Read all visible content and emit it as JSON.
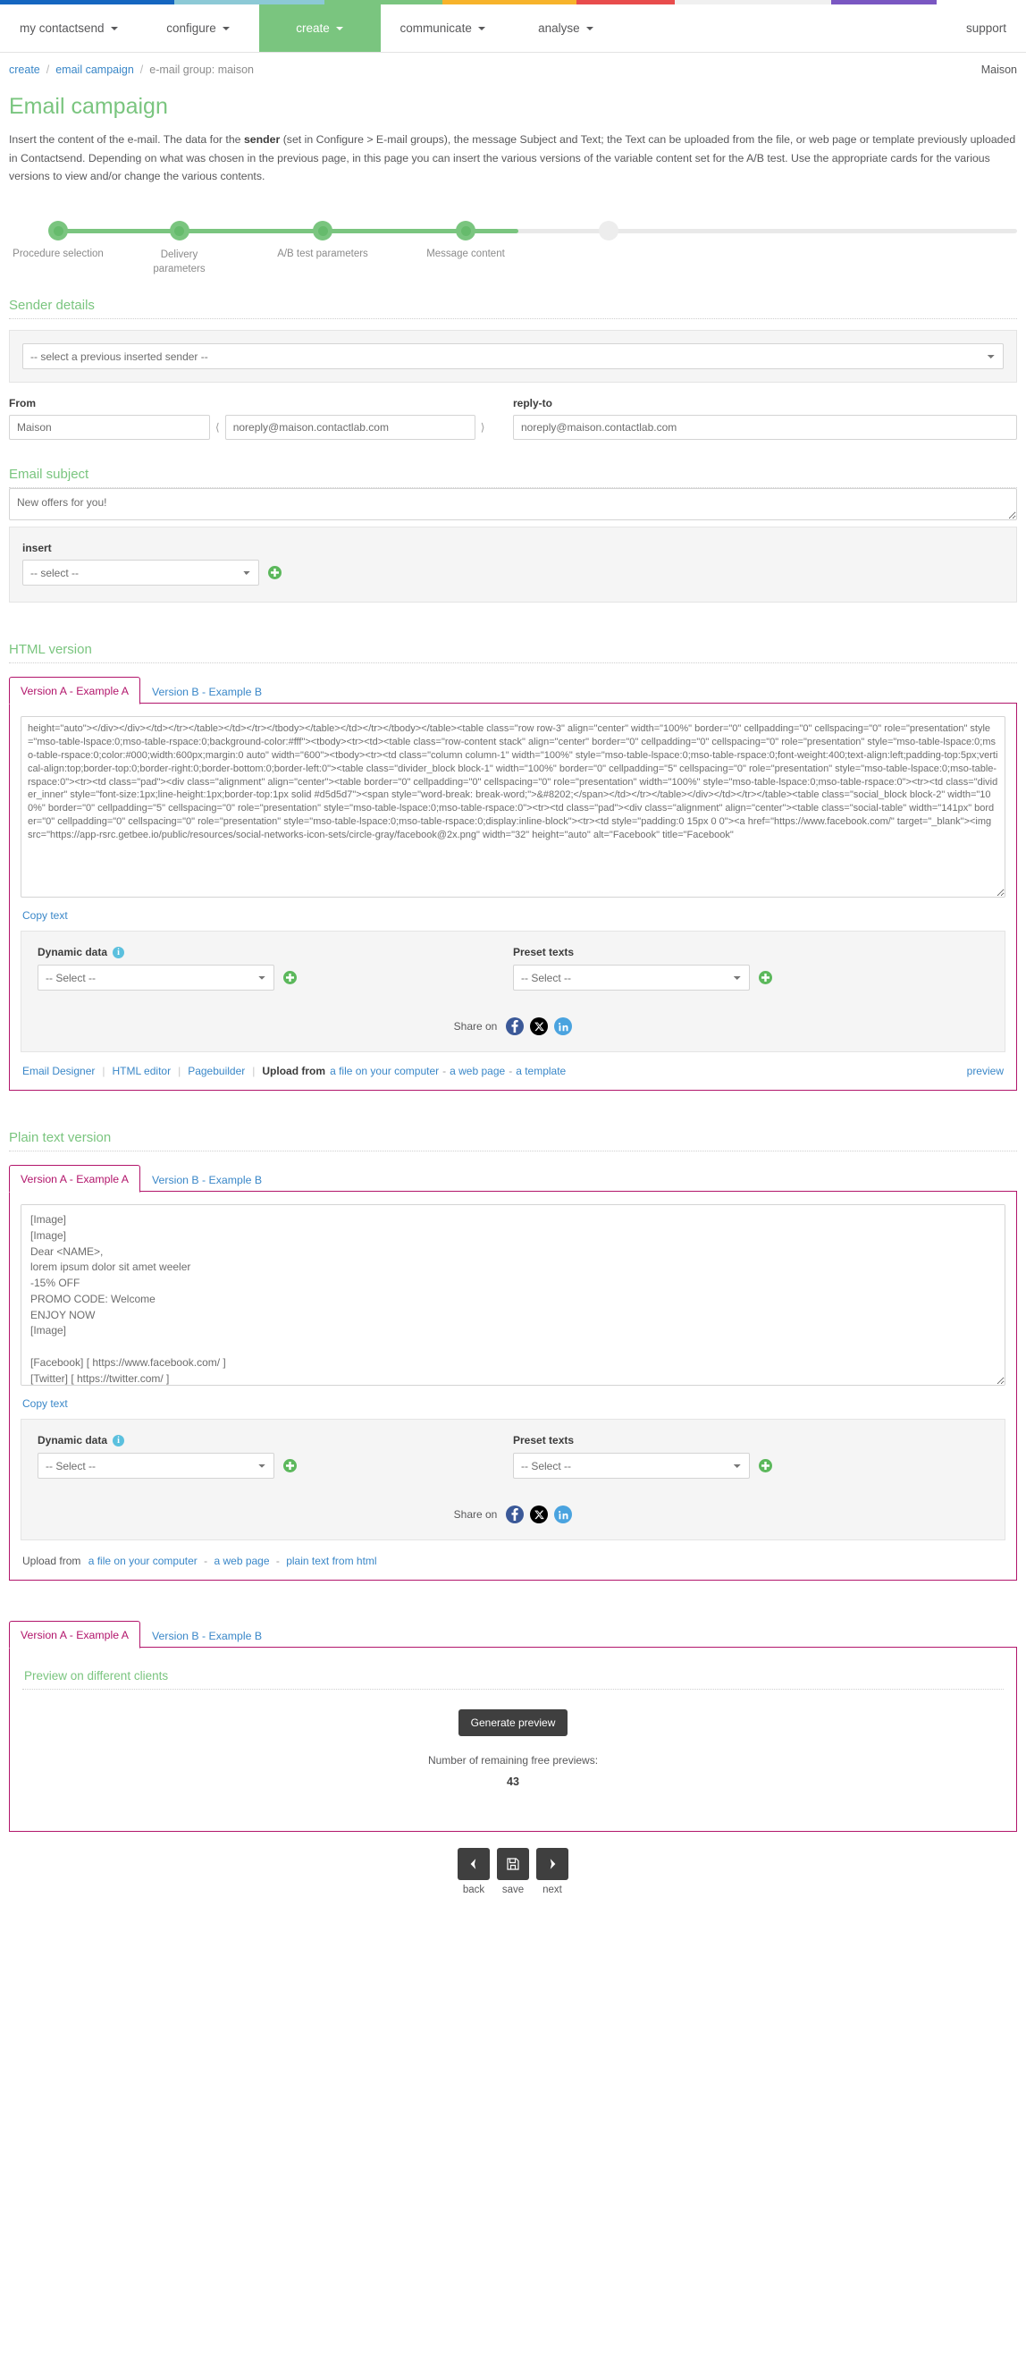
{
  "topstrip": {
    "segments": [
      {
        "color": "#1566c0",
        "width": 195
      },
      {
        "color": "#8cc9d6",
        "width": 168
      },
      {
        "color": "#7ac57f",
        "width": 132
      },
      {
        "color": "#f7b32b",
        "width": 150
      },
      {
        "color": "#e84c4c",
        "width": 110
      },
      {
        "color": "#f0f0f0",
        "width": 175
      },
      {
        "color": "#7a57c2",
        "width": 118
      }
    ]
  },
  "nav": {
    "items": [
      {
        "label": "my contactsend",
        "caret": true,
        "active": false
      },
      {
        "label": "configure",
        "caret": true,
        "active": false
      },
      {
        "label": "create",
        "caret": true,
        "active": true
      },
      {
        "label": "communicate",
        "caret": true,
        "active": false
      },
      {
        "label": "analyse",
        "caret": true,
        "active": false
      }
    ],
    "support_label": "support"
  },
  "breadcrumb": {
    "items": [
      "create",
      "email campaign",
      "e-mail group: maison"
    ],
    "account": "Maison"
  },
  "header": {
    "title": "Email campaign",
    "intro_part1": "Insert the content of the e-mail. The data for the ",
    "intro_bold": "sender",
    "intro_part2": " (set in Configure > E-mail groups), the message Subject and Text; the Text can be uploaded from the file, or web page or template previously uploaded in Contactsend. Depending on what was chosen in the previous page, in this page you can insert the various versions of the variable content set for the A/B test. Use the appropriate cards for the various versions to view and/or change the various contents."
  },
  "stepper": {
    "steps": [
      {
        "label": "Procedure selection",
        "done": true
      },
      {
        "label": "Delivery parameters",
        "done": true
      },
      {
        "label": "A/B test parameters",
        "done": true
      },
      {
        "label": "Message content",
        "done": true
      },
      {
        "label": "",
        "done": false
      }
    ]
  },
  "sender": {
    "heading": "Sender details",
    "previous_sender_select": "-- select a previous inserted sender --",
    "from_label": "From",
    "from_name": "Maison",
    "from_email": "noreply@maison.contactlab.com",
    "replyto_label": "reply-to",
    "replyto_value": "noreply@maison.contactlab.com"
  },
  "subject": {
    "heading": "Email subject",
    "value": "New offers for you!",
    "insert_label": "insert",
    "insert_select": "-- select --"
  },
  "html_version": {
    "heading": "HTML version",
    "tabs": [
      {
        "label": "Version A - Example A",
        "active": true
      },
      {
        "label": "Version B - Example B",
        "active": false
      }
    ],
    "content": "height=\"auto\"></div></div></td></tr></table></td></tr></tbody></table></td></tr></tbody></table><table class=\"row row-3\" align=\"center\" width=\"100%\" border=\"0\" cellpadding=\"0\" cellspacing=\"0\" role=\"presentation\" style=\"mso-table-lspace:0;mso-table-rspace:0;background-color:#fff\"><tbody><tr><td><table class=\"row-content stack\" align=\"center\" border=\"0\" cellpadding=\"0\" cellspacing=\"0\" role=\"presentation\" style=\"mso-table-lspace:0;mso-table-rspace:0;color:#000;width:600px;margin:0 auto\" width=\"600\"><tbody><tr><td class=\"column column-1\" width=\"100%\" style=\"mso-table-lspace:0;mso-table-rspace:0;font-weight:400;text-align:left;padding-top:5px;vertical-align:top;border-top:0;border-right:0;border-bottom:0;border-left:0\"><table class=\"divider_block block-1\" width=\"100%\" border=\"0\" cellpadding=\"5\" cellspacing=\"0\" role=\"presentation\" style=\"mso-table-lspace:0;mso-table-rspace:0\"><tr><td class=\"pad\"><div class=\"alignment\" align=\"center\"><table border=\"0\" cellpadding=\"0\" cellspacing=\"0\" role=\"presentation\" width=\"100%\" style=\"mso-table-lspace:0;mso-table-rspace:0\"><tr><td class=\"divider_inner\" style=\"font-size:1px;line-height:1px;border-top:1px solid #d5d5d7\"><span style=\"word-break: break-word;\">&#8202;</span></td></tr></table></div></td></tr></table><table class=\"social_block block-2\" width=\"100%\" border=\"0\" cellpadding=\"5\" cellspacing=\"0\" role=\"presentation\" style=\"mso-table-lspace:0;mso-table-rspace:0\"><tr><td class=\"pad\"><div class=\"alignment\" align=\"center\"><table class=\"social-table\" width=\"141px\" border=\"0\" cellpadding=\"0\" cellspacing=\"0\" role=\"presentation\" style=\"mso-table-lspace:0;mso-table-rspace:0;display:inline-block\"><tr><td style=\"padding:0 15px 0 0\"><a href=\"https://www.facebook.com/\" target=\"_blank\"><img src=\"https://app-rsrc.getbee.io/public/resources/social-networks-icon-sets/circle-gray/facebook@2x.png\" width=\"32\" height=\"auto\" alt=\"Facebook\" title=\"Facebook\"",
    "copy_text": "Copy text",
    "dynamic_data_label": "Dynamic data",
    "dynamic_data_select": "-- Select --",
    "preset_texts_label": "Preset texts",
    "preset_texts_select": "-- Select --",
    "share_label": "Share on",
    "share_icons": [
      "facebook-icon",
      "x-twitter-icon",
      "linkedin-icon"
    ],
    "footer": {
      "email_designer": "Email Designer",
      "html_editor": "HTML editor",
      "pagebuilder": "Pagebuilder",
      "upload_from": "Upload from",
      "upload_file": "a file on your computer",
      "upload_webpage": "a web page",
      "upload_template": "a template",
      "preview": "preview"
    }
  },
  "plain_version": {
    "heading": "Plain text version",
    "tabs": [
      {
        "label": "Version A - Example A",
        "active": true
      },
      {
        "label": "Version B - Example B",
        "active": false
      }
    ],
    "content": "[Image]\n[Image]\nDear <NAME>,\nlorem ipsum dolor sit amet weeler\n-15% OFF\nPROMO CODE: Welcome\nENJOY NOW\n[Image]\n\n[Facebook] [ https://www.facebook.com/ ]\n[Twitter] [ https://twitter.com/ ]\n[Google+] [ https://plus.google.com/ ]",
    "copy_text": "Copy text",
    "dynamic_data_label": "Dynamic data",
    "dynamic_data_select": "-- Select --",
    "preset_texts_label": "Preset texts",
    "preset_texts_select": "-- Select --",
    "share_label": "Share on",
    "footer": {
      "upload_from": "Upload from",
      "upload_file": "a file on your computer",
      "upload_webpage": "a web page",
      "upload_plaintext": "plain text from html"
    }
  },
  "preview_card": {
    "tabs": [
      {
        "label": "Version A - Example A",
        "active": true
      },
      {
        "label": "Version B - Example B",
        "active": false
      }
    ],
    "heading": "Preview on different clients",
    "generate_button": "Generate preview",
    "remaining_label": "Number of remaining free previews:",
    "remaining_count": "43"
  },
  "bottom_nav": [
    {
      "label": "back",
      "icon": "chevron-left-icon"
    },
    {
      "label": "save",
      "icon": "floppy-disk-icon"
    },
    {
      "label": "next",
      "icon": "chevron-right-icon"
    }
  ],
  "colors": {
    "brand_green": "#7ac57f",
    "card_pink": "#b2156b",
    "link_blue": "#3a87c8"
  }
}
